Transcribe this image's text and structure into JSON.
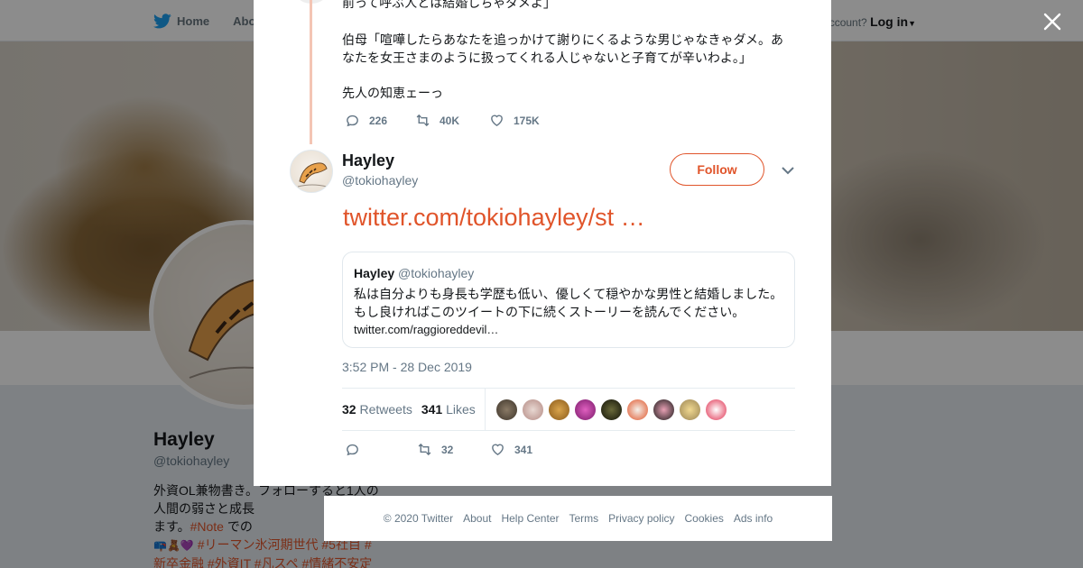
{
  "background": {
    "nav": [
      {
        "label": "Home"
      },
      {
        "label": "Abo"
      }
    ],
    "login": {
      "prompt": "ccount?",
      "action": "Log in"
    },
    "profile": {
      "name": "Hayley",
      "handle": "@tokiohayley",
      "bio_lines": [
        "外資OL兼物書き。フォローすると1人の",
        "人間の弱さと成長",
        "ます。",
        "",
        "新卒金融 #外資IT #凡スペ #情緒不安定"
      ],
      "bio_note_tag": "#Note",
      "bio_note_after": " での",
      "bio_tags_line": "#リーマン氷河期世代 #5社目 #",
      "ads_info_fragment": "Ads info"
    }
  },
  "modal": {
    "previous_tweet": {
      "lines": [
        "前って呼ぶ人とは結婚しちゃダメよ」",
        "伯母「喧嘩したらあなたを追っかけて謝りにくるような男じゃなきゃダメ。あ",
        "なたを女王さまのように扱ってくれる人じゃないと子育てが辛いわよ。」",
        "先人の知恵ェーっ"
      ],
      "replies": "226",
      "retweets": "40K",
      "likes": "175K"
    },
    "tweet": {
      "author_name": "Hayley",
      "author_handle": "@tokiohayley",
      "follow_label": "Follow",
      "link_text": "twitter.com/tokiohayley/st …",
      "quote": {
        "name": "Hayley",
        "handle": "@tokiohayley",
        "lines": [
          "私は自分よりも身長も学歴も低い、優しくて穏やかな男性と結婚しました。",
          "もし良ければこのツイートの下に続くストーリーを読んでください。",
          "twitter.com/raggioreddevil…"
        ]
      },
      "timestamp": "3:52 PM - 28 Dec 2019",
      "retweet_count": "32",
      "retweet_label": "Retweets",
      "like_count": "341",
      "like_label": "Likes",
      "action_retweets": "32",
      "action_likes": "341"
    }
  },
  "footer": {
    "links": [
      "© 2020 Twitter",
      "About",
      "Help Center",
      "Terms",
      "Privacy policy",
      "Cookies",
      "Ads info"
    ]
  },
  "colors": {
    "accent": "#e0542a",
    "thread_line": "#f4c5b4",
    "twitter_blue": "#1da1f2",
    "secondary_text": "#657786"
  },
  "icons": {
    "close": "close-icon",
    "bird": "twitter-bird-icon",
    "reply": "reply-icon",
    "retweet": "retweet-icon",
    "like": "heart-icon",
    "menu": "chevron-down-icon"
  }
}
